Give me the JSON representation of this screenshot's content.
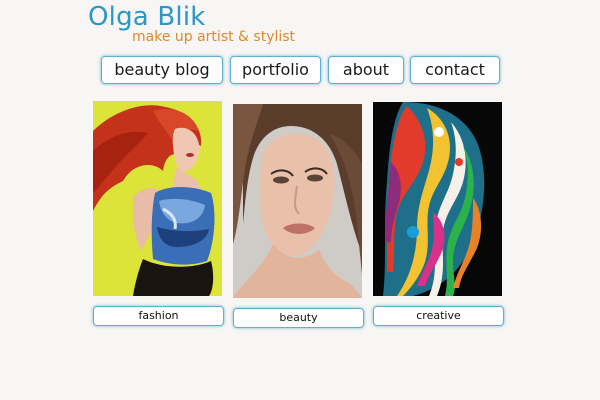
{
  "header": {
    "title": "Olga Blik",
    "tagline": "make up artist & stylist"
  },
  "nav": {
    "items": [
      {
        "label": "beauty blog"
      },
      {
        "label": "portfolio"
      },
      {
        "label": "about"
      },
      {
        "label": "contact"
      }
    ]
  },
  "gallery": {
    "items": [
      {
        "caption": "fashion",
        "image": "red-haired-model-photo"
      },
      {
        "caption": "beauty",
        "image": "brunette-portrait-photo"
      },
      {
        "caption": "creative",
        "image": "colorful-body-paint-photo"
      }
    ]
  },
  "colors": {
    "title": "#2a97c7",
    "tagline": "#d9892c",
    "button_border": "#5fb1cf",
    "background": "#f8f6f4"
  }
}
